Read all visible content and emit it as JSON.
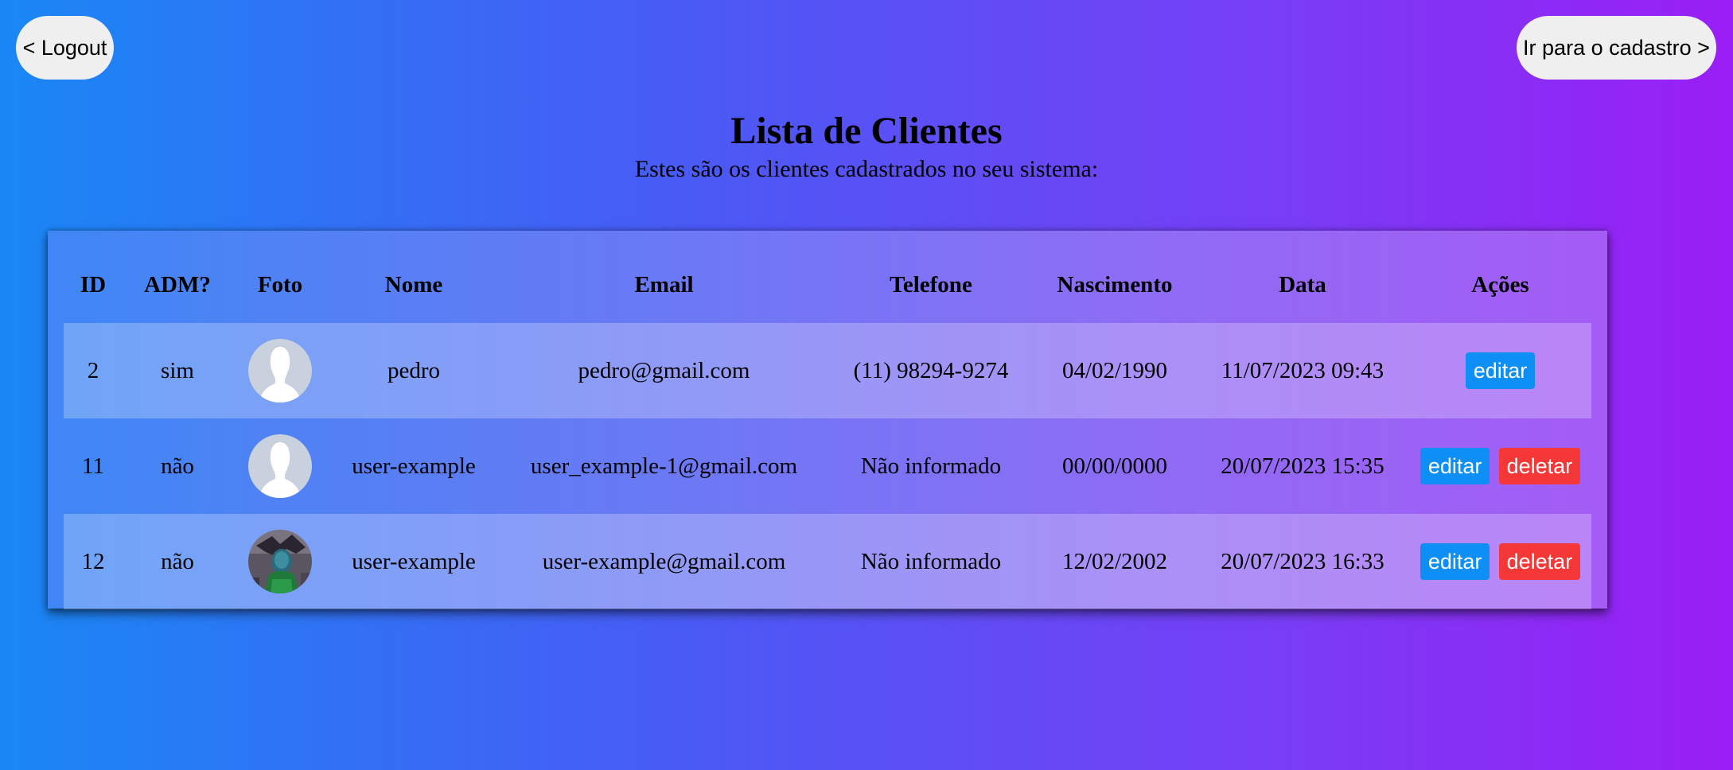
{
  "nav": {
    "logout_label": "< Logout",
    "cadastro_label": "Ir para o cadastro >"
  },
  "page": {
    "title": "Lista de Clientes",
    "subtitle": "Estes são os clientes cadastrados no seu sistema:"
  },
  "table": {
    "headers": {
      "id": "ID",
      "adm": "ADM?",
      "foto": "Foto",
      "nome": "Nome",
      "email": "Email",
      "telefone": "Telefone",
      "nascimento": "Nascimento",
      "data": "Data",
      "acoes": "Ações"
    },
    "rows": [
      {
        "id": "2",
        "adm": "sim",
        "photo": "default-avatar-icon",
        "nome": "pedro",
        "email": "pedro@gmail.com",
        "telefone": "(11) 98294-9274",
        "nascimento": "04/02/1990",
        "data": "11/07/2023 09:43",
        "edit_label": "editar"
      },
      {
        "id": "11",
        "adm": "não",
        "photo": "default-avatar-icon",
        "nome": "user-example",
        "email": "user_example-1@gmail.com",
        "telefone": "Não informado",
        "nascimento": "00/00/0000",
        "data": "20/07/2023 15:35",
        "edit_label": "editar",
        "delete_label": "deletar"
      },
      {
        "id": "12",
        "adm": "não",
        "photo": "custom-photo",
        "nome": "user-example",
        "email": "user-example@gmail.com",
        "telefone": "Não informado",
        "nascimento": "12/02/2002",
        "data": "20/07/2023 16:33",
        "edit_label": "editar",
        "delete_label": "deletar"
      }
    ]
  },
  "colors": {
    "background_start": "#1a87f5",
    "background_end": "#9a1ef5",
    "edit_button": "#0d8ff5",
    "delete_button": "#f53737",
    "nav_button": "#efefef"
  }
}
